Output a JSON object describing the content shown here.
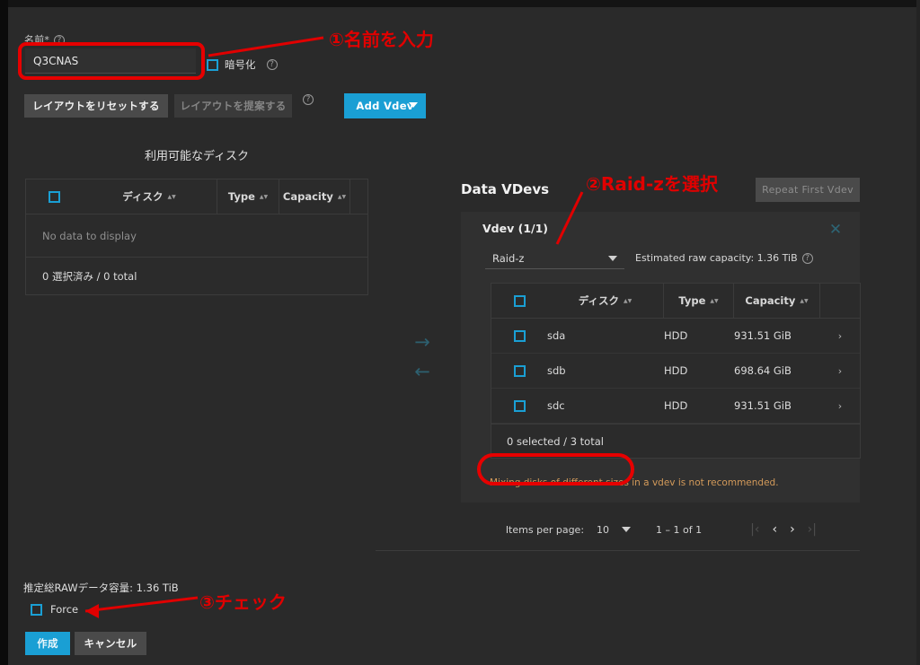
{
  "form": {
    "name_label": "名前*",
    "name_value": "Q3CNAS",
    "encryption_label": "暗号化",
    "reset_layout_label": "レイアウトをリセットする",
    "suggest_layout_label": "レイアウトを提案する",
    "add_vdev_label": "Add Vdev",
    "raw_capacity_label": "推定総RAWデータ容量: 1.36 TiB",
    "force_label": "Force",
    "create_label": "作成",
    "cancel_label": "キャンセル",
    "help_glyph": "?"
  },
  "available_disks": {
    "title": "利用可能なディスク",
    "columns": [
      "ディスク",
      "Type",
      "Capacity"
    ],
    "empty_message": "No data to display",
    "footer": "0 選択済み / 0 total"
  },
  "data_vdevs": {
    "title": "Data VDevs",
    "repeat_first_vdev_label": "Repeat First Vdev",
    "vdev_title": "Vdev (1/1)",
    "vdev_type_value": "Raid-z",
    "estimated_capacity": "Estimated raw capacity: 1.36 TiB",
    "close_glyph": "✕",
    "columns": [
      "ディスク",
      "Type",
      "Capacity"
    ],
    "rows": [
      {
        "disk": "sda",
        "type": "HDD",
        "capacity": "931.51 GiB",
        "chevron": "›"
      },
      {
        "disk": "sdb",
        "type": "HDD",
        "capacity": "698.64 GiB",
        "chevron": "›"
      },
      {
        "disk": "sdc",
        "type": "HDD",
        "capacity": "931.51 GiB",
        "chevron": "›"
      }
    ],
    "footer": "0 selected / 3 total",
    "warning": "Mixing disks of different sizes in a vdev is not recommended."
  },
  "transfer": {
    "right_glyph": "→",
    "left_glyph": "←"
  },
  "paginator": {
    "items_per_page_label": "Items per page:",
    "items_per_page_value": "10",
    "range_label": "1 – 1 of 1",
    "first_glyph": "|‹",
    "prev_glyph": "‹",
    "next_glyph": "›",
    "last_glyph": "›|"
  },
  "annotations": [
    {
      "id": 1,
      "text": "①名前を入力"
    },
    {
      "id": 2,
      "text": "②Raid-zを選択"
    },
    {
      "id": 3,
      "text": "③チェック"
    }
  ],
  "colors": {
    "accent": "#1a9fd4",
    "annotation": "#e00000",
    "warning": "#d39a5a",
    "panel": "#303030",
    "background": "#2a2a2a"
  }
}
